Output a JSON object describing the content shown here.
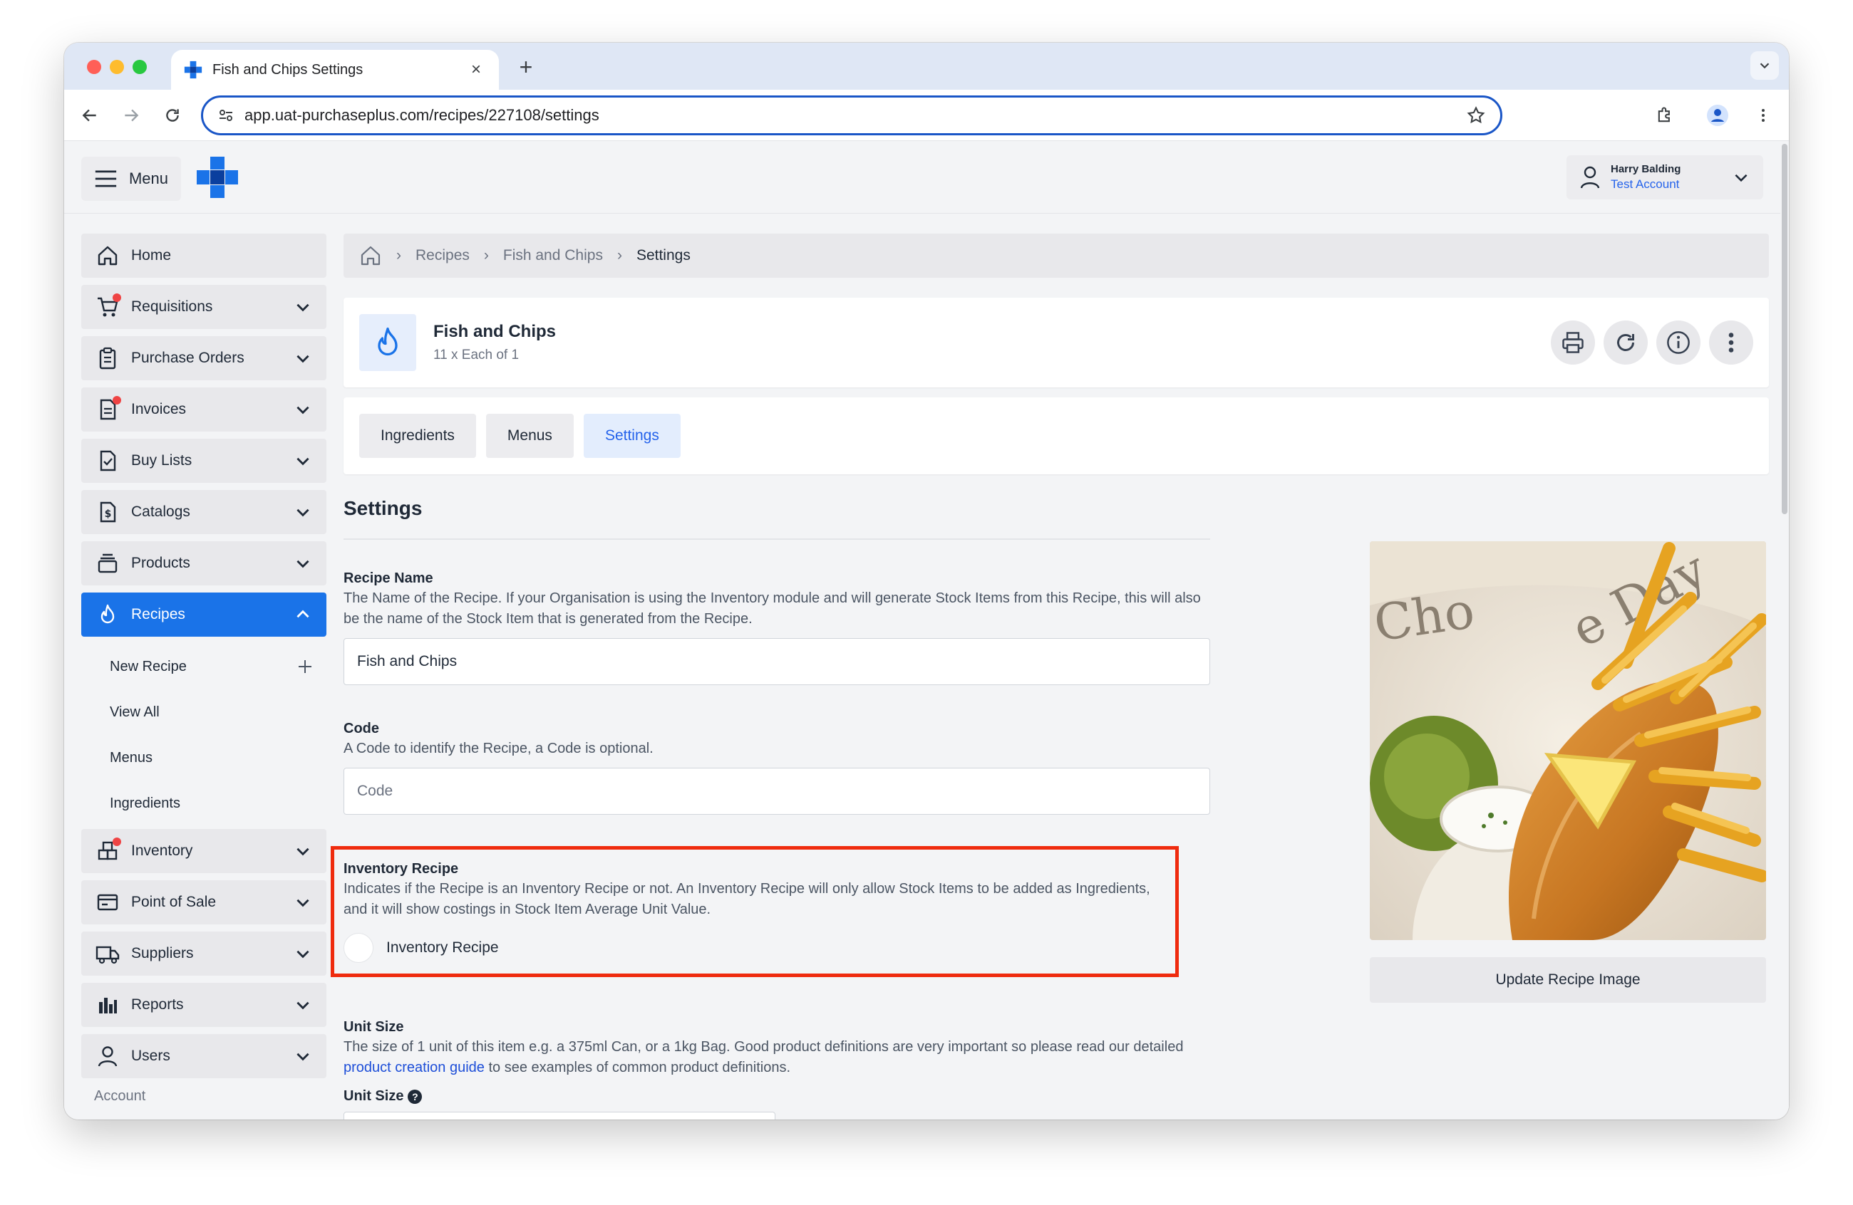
{
  "browser": {
    "tab_title": "Fish and Chips Settings",
    "url": "app.uat-purchaseplus.com/recipes/227108/settings",
    "colors": {
      "accent": "#1a56c7",
      "tabstrip": "#dfe7f5"
    }
  },
  "header": {
    "menu_label": "Menu",
    "user_name": "Harry Balding",
    "org_name": "Test Account"
  },
  "sidebar": {
    "items": [
      {
        "label": "Home",
        "icon": "home-icon"
      },
      {
        "label": "Requisitions",
        "icon": "cart-icon"
      },
      {
        "label": "Purchase Orders",
        "icon": "clipboard-icon"
      },
      {
        "label": "Invoices",
        "icon": "invoice-icon"
      },
      {
        "label": "Buy Lists",
        "icon": "checklist-icon"
      },
      {
        "label": "Catalogs",
        "icon": "catalog-dollar-icon"
      },
      {
        "label": "Products",
        "icon": "products-stack-icon"
      },
      {
        "label": "Recipes",
        "icon": "flame-icon"
      }
    ],
    "recipes_sub": [
      {
        "label": "New Recipe"
      },
      {
        "label": "View All"
      },
      {
        "label": "Menus"
      },
      {
        "label": "Ingredients"
      }
    ],
    "items_after": [
      {
        "label": "Inventory",
        "icon": "inventory-icon"
      },
      {
        "label": "Point of Sale",
        "icon": "pos-card-icon"
      },
      {
        "label": "Suppliers",
        "icon": "truck-icon"
      },
      {
        "label": "Reports",
        "icon": "bar-chart-icon"
      },
      {
        "label": "Users",
        "icon": "user-icon"
      }
    ],
    "footer_label": "Account"
  },
  "breadcrumb": {
    "items": [
      "Recipes",
      "Fish and Chips",
      "Settings"
    ]
  },
  "recipe": {
    "title": "Fish and Chips",
    "subtitle": "11 x Each of 1"
  },
  "tabs": [
    {
      "label": "Ingredients"
    },
    {
      "label": "Menus"
    },
    {
      "label": "Settings"
    }
  ],
  "settings": {
    "heading": "Settings",
    "recipe_name": {
      "label": "Recipe Name",
      "description": "The Name of the Recipe. If your Organisation is using the Inventory module and will generate Stock Items from this Recipe, this will also be the name of the Stock Item that is generated from the Recipe.",
      "value": "Fish and Chips"
    },
    "code": {
      "label": "Code",
      "description": "A Code to identify the Recipe, a Code is optional.",
      "placeholder": "Code"
    },
    "inventory_recipe": {
      "label": "Inventory Recipe",
      "description": "Indicates if the Recipe is an Inventory Recipe or not. An Inventory Recipe will only allow Stock Items to be added as Ingredients, and it will show costings in Stock Item Average Unit Value.",
      "toggle_label": "Inventory Recipe",
      "checked": false
    },
    "unit_size": {
      "label": "Unit Size",
      "description_before": "The size of 1 unit of this item e.g. a 375ml Can, or a 1kg Bag. Good product definitions are very important so please read our detailed",
      "link_text": "product creation guide",
      "description_after": "to see examples of common product definitions.",
      "field_label": "Unit Size"
    },
    "update_image_label": "Update Recipe Image"
  }
}
